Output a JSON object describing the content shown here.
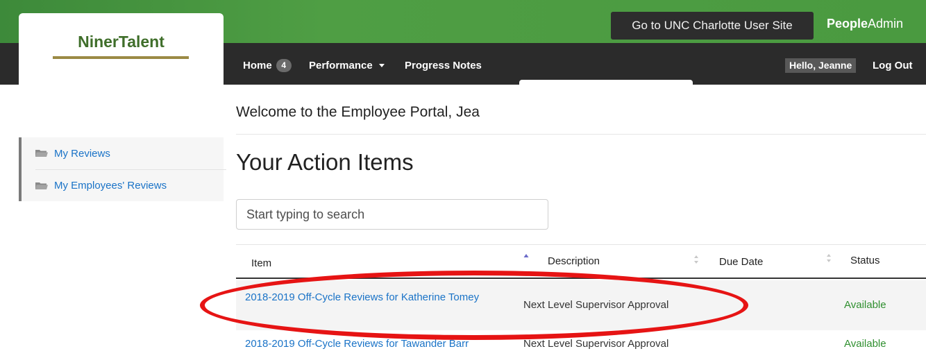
{
  "header": {
    "logo_text": "NinerTalent",
    "site_button_label": "Go to UNC Charlotte User Site",
    "brand_bold": "People",
    "brand_regular": "Admin"
  },
  "nav": {
    "home_label": "Home",
    "home_count": "4",
    "performance_label": "Performance",
    "progress_notes_label": "Progress Notes",
    "greeting": "Hello, Jeanne",
    "logout_label": "Log Out"
  },
  "main": {
    "welcome_text": "Welcome to the Employee Portal,",
    "welcome_name": "Jea",
    "heading": "Your Action Items",
    "search_placeholder": "Start typing to search"
  },
  "sidebar": {
    "items": [
      {
        "label": "My Reviews",
        "icon": "folder-icon"
      },
      {
        "label": "My Employees' Reviews",
        "icon": "folder-icon"
      }
    ]
  },
  "table": {
    "columns": [
      "Item",
      "Description",
      "Due Date",
      "Status"
    ],
    "rows": [
      {
        "item": "2018-2019 Off-Cycle Reviews for Katherine Tomey",
        "description": "Next Level Supervisor Approval",
        "due_date": "",
        "status": "Available"
      },
      {
        "item": "2018-2019 Off-Cycle Reviews for Tawander Barr",
        "description": "Next Level Supervisor Approval",
        "due_date": "",
        "status": "Available"
      }
    ]
  },
  "colors": {
    "header_green": "#4a9a40",
    "nav_dark": "#2b2b2b",
    "link_blue": "#1a73c7",
    "status_green": "#2f8f2f",
    "highlight_red": "#e61414"
  }
}
